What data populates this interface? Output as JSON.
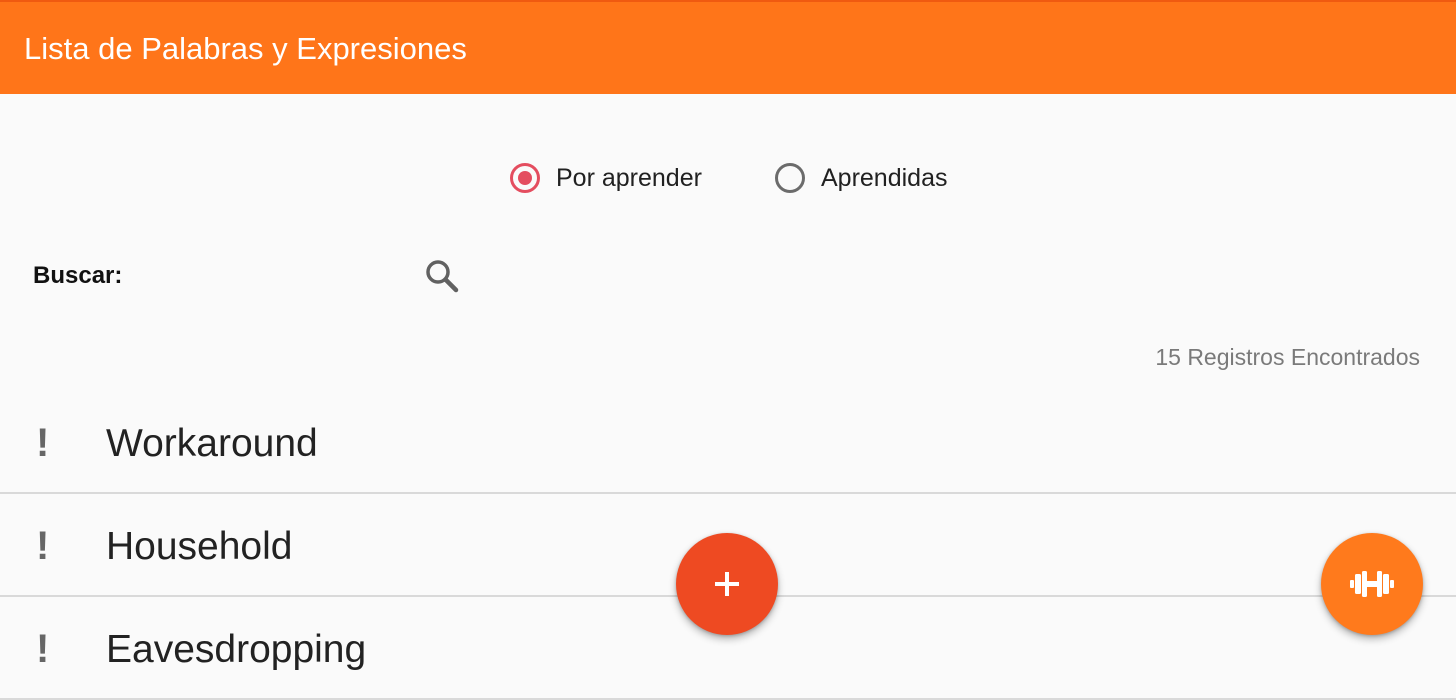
{
  "appbar": {
    "title": "Lista de Palabras y Expresiones",
    "color": "#ff7519"
  },
  "filter": {
    "options": [
      {
        "label": "Por aprender",
        "selected": true
      },
      {
        "label": "Aprendidas",
        "selected": false
      }
    ],
    "accent_color": "#e44d5f"
  },
  "search": {
    "label": "Buscar:",
    "value": "",
    "icon": "search-icon"
  },
  "records_text": "15 Registros Encontrados",
  "list": {
    "items": [
      {
        "mark": "!",
        "word": "Workaround"
      },
      {
        "mark": "!",
        "word": "Household"
      },
      {
        "mark": "!",
        "word": "Eavesdropping"
      }
    ]
  },
  "fabs": {
    "add": {
      "icon": "plus-icon",
      "color": "#ee4a22"
    },
    "train": {
      "icon": "dumbbell-icon",
      "color": "#ff7a1c"
    }
  }
}
